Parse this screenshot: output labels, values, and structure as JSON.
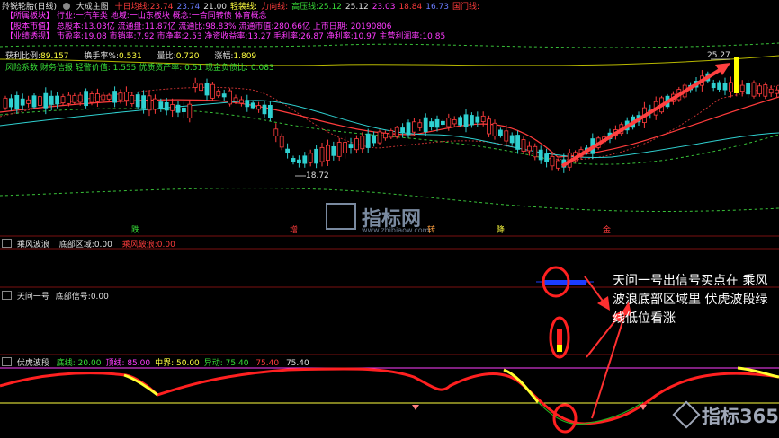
{
  "header": {
    "name": "羚锐轮胎(日线)",
    "indicator": "大成主图",
    "items": [
      {
        "label": "十日均线:",
        "value": "23.74",
        "color": "#ff3c3c"
      },
      {
        "label": "",
        "value": "23.74",
        "color": "#6a7cff"
      },
      {
        "label": "",
        "value": "21.00",
        "color": "#e0e0e0"
      },
      {
        "label": "轻装线:",
        "value": "",
        "color": "#ffff40"
      },
      {
        "label": "力向线:",
        "value": "",
        "color": "#ff3c3c"
      },
      {
        "label": "高压线:",
        "value": "25.12",
        "color": "#38e038"
      },
      {
        "label": "",
        "value": "25.12",
        "color": "#e0e0e0"
      },
      {
        "label": "",
        "value": "23.03",
        "color": "#ff3cff"
      },
      {
        "label": "",
        "value": "18.84",
        "color": "#ff3c3c"
      },
      {
        "label": "",
        "value": "16.73",
        "color": "#6a7cff"
      },
      {
        "label": "",
        "value": "国门线:",
        "color": "#ff3c3c"
      }
    ]
  },
  "info_rows": [
    {
      "tag": "【所属板块】",
      "text": "行业:一汽车类    地域:一山东板块    概念:一合同转债 体育概念"
    },
    {
      "tag": "【股本市值】",
      "text": "总股本:13.03亿  流通盘:11.87亿   流通比:98.83%   流通市值:280.66亿   上市日期: 20190806"
    },
    {
      "tag": "【业绩透视】",
      "text": "市盈率:19.08   市销率:7.92   市净率:2.53   净资收益率:13.27   毛利率:26.87   净利率:10.97   主营利润率:10.85"
    }
  ],
  "profit_row": {
    "l1": "获利比例:",
    "v1": "89.157",
    "l2": "换手率%:",
    "v2": "0.531",
    "l3": "量比:",
    "v3": "0.720",
    "l4": "涨幅:",
    "v4": "1.809"
  },
  "risk_row": "风险系数 财务信报 轻警价值: 1.555 优质资产率: 0.51  现金负债比: 0.083",
  "price_labels": {
    "high": "25.27",
    "low": "18.72"
  },
  "signals": [
    "跌",
    "增",
    "转",
    "降",
    "金"
  ],
  "watermark": {
    "text": "指标网",
    "sub": "www.zhibiaow.com"
  },
  "panel1": {
    "name": "乘风波浪",
    "l1": "底部区域:",
    "v1": "0.00",
    "l2": "乘风破浪:",
    "v2": "0.00"
  },
  "panel2": {
    "name": "天问一号",
    "l1": "底部信号:",
    "v1": "0.00"
  },
  "panel3": {
    "name": "伏虎波段",
    "items": [
      {
        "label": "底线:",
        "value": "20.00",
        "color": "#38e038"
      },
      {
        "label": "顶线:",
        "value": "85.00",
        "color": "#ff3cff"
      },
      {
        "label": "中界:",
        "value": "50.00",
        "color": "#ffff40"
      },
      {
        "label": "异动:",
        "value": "75.40",
        "color": "#38e038"
      },
      {
        "label": "",
        "value": "75.40",
        "color": "#ff3c3c"
      },
      {
        "label": "",
        "value": "75.40",
        "color": "#e0e0e0"
      }
    ]
  },
  "annotation": "天问一号出信号买点在 乘风波浪底部区域里 伏虎波段绿线低位看涨",
  "brand": "指标365",
  "colors": {
    "up": "#ff3c3c",
    "down": "#2fd0d0",
    "ma": "#ff3c3c",
    "green_band": "#38c038",
    "yellow_band": "#b8b800"
  }
}
